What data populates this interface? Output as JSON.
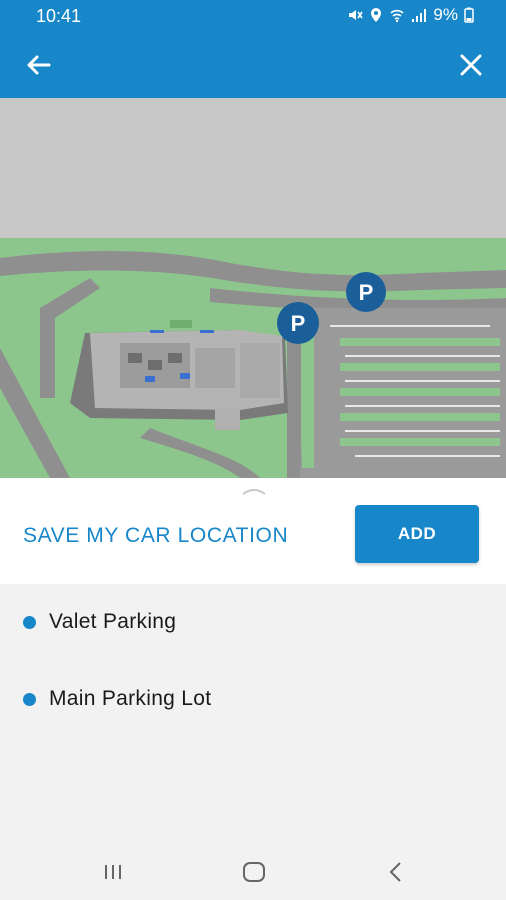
{
  "status_bar": {
    "time": "10:41",
    "battery": "9%",
    "icons": [
      "mute-icon",
      "location-icon",
      "wifi-icon",
      "signal-icon",
      "battery-icon"
    ]
  },
  "app_bar": {
    "back_icon": "arrow-left-icon",
    "close_icon": "close-icon",
    "color": "#1787c9"
  },
  "map": {
    "parking_markers": [
      "P",
      "P"
    ]
  },
  "panel": {
    "save_label": "SAVE MY CAR LOCATION",
    "add_label": "ADD"
  },
  "list": {
    "items": [
      {
        "label": "Valet Parking"
      },
      {
        "label": "Main Parking Lot"
      }
    ]
  },
  "nav_bar": {
    "icons": [
      "recent-apps-icon",
      "home-icon",
      "back-icon"
    ]
  }
}
